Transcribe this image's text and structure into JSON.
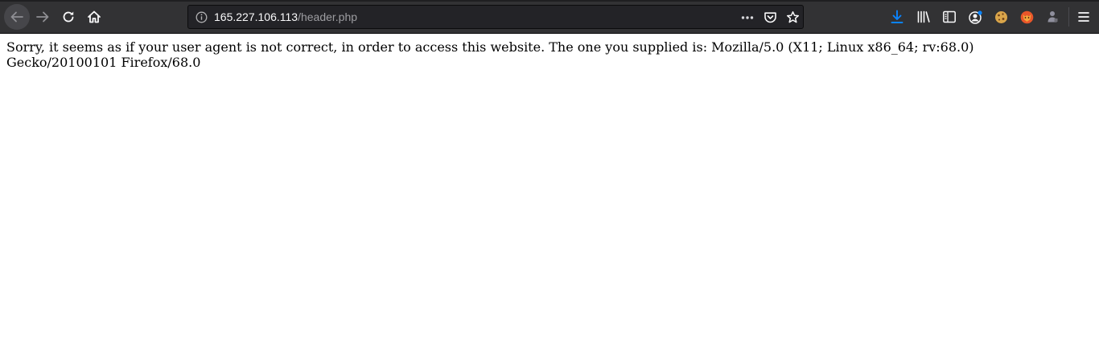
{
  "browser": {
    "url_host": "165.227.106.113",
    "url_path": "/header.php"
  },
  "page": {
    "message": "Sorry, it seems as if your user agent is not correct, in order to access this website. The one you supplied is: Mozilla/5.0 (X11; Linux x86_64; rv:68.0) Gecko/20100101 Firefox/68.0"
  },
  "colors": {
    "toolbar_bg": "#323234",
    "urlbar_bg": "#232327",
    "download_accent": "#0a84ff"
  },
  "icons": {
    "back": "arrow-left-icon",
    "forward": "arrow-right-icon",
    "reload": "reload-icon",
    "home": "home-icon",
    "site_info": "info-icon",
    "page_actions": "more-dots-icon",
    "pocket": "pocket-icon",
    "bookmark": "star-icon",
    "downloads": "download-icon",
    "library": "library-icon",
    "sidebar": "sidebar-icon",
    "account": "account-icon",
    "cookie_extension": "cookie-icon",
    "fox_extension": "fox-icon",
    "extension": "puzzle-person-icon",
    "menu": "hamburger-menu-icon"
  }
}
